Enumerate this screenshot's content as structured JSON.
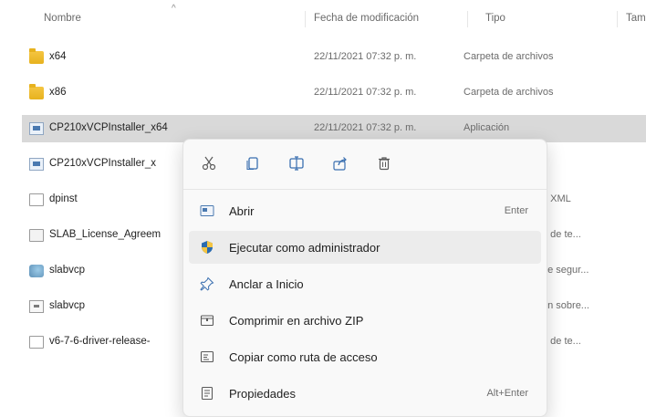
{
  "header": {
    "col_name": "Nombre",
    "col_date": "Fecha de modificación",
    "col_type": "Tipo",
    "col_size": "Tam",
    "sort_arrow": "^"
  },
  "files": [
    {
      "name": "x64",
      "date": "22/11/2021 07:32 p. m.",
      "type": "Carpeta de archivos",
      "icon": "folder-icon"
    },
    {
      "name": "x86",
      "date": "22/11/2021 07:32 p. m.",
      "type": "Carpeta de archivos",
      "icon": "folder-icon"
    },
    {
      "name": "CP210xVCPInstaller_x64",
      "date": "22/11/2021 07:32 p. m.",
      "type": "Aplicación",
      "icon": "application-icon"
    },
    {
      "name": "CP210xVCPInstaller_x",
      "type_cut": "i",
      "icon": "application-icon"
    },
    {
      "name": "dpinst",
      "type_cut": "o XML",
      "icon": "document-icon"
    },
    {
      "name": "SLAB_License_Agreem",
      "type_cut": "o de te...",
      "icon": "document-icon"
    },
    {
      "name": "slabvcp",
      "type_cut": "de segur...",
      "icon": "security-catalog-icon"
    },
    {
      "name": "slabvcp",
      "type_cut": "ón sobre...",
      "icon": "setup-information-icon"
    },
    {
      "name": "v6-7-6-driver-release-",
      "type_cut": "o de te...",
      "icon": "document-icon"
    }
  ],
  "context_menu": {
    "toolbar": [
      {
        "name": "cut-icon",
        "label": "Cortar"
      },
      {
        "name": "copy-icon",
        "label": "Copiar"
      },
      {
        "name": "rename-icon",
        "label": "Cambiar nombre"
      },
      {
        "name": "share-icon",
        "label": "Compartir"
      },
      {
        "name": "delete-icon",
        "label": "Eliminar"
      }
    ],
    "items": [
      {
        "label": "Abrir",
        "shortcut": "Enter",
        "icon": "open-icon"
      },
      {
        "label": "Ejecutar como administrador",
        "shortcut": "",
        "icon": "admin-shield-icon"
      },
      {
        "label": "Anclar a Inicio",
        "shortcut": "",
        "icon": "pin-icon"
      },
      {
        "label": "Comprimir en archivo ZIP",
        "shortcut": "",
        "icon": "zip-icon"
      },
      {
        "label": "Copiar como ruta de acceso",
        "shortcut": "",
        "icon": "copy-path-icon"
      },
      {
        "label": "Propiedades",
        "shortcut": "Alt+Enter",
        "icon": "properties-icon"
      }
    ]
  },
  "colors": {
    "selected_row": "#d9d9d9",
    "menu_background": "#f9f9f9",
    "menu_hover": "#ececec",
    "folder": "#f5c542",
    "accent_blue": "#2b6cb0"
  }
}
